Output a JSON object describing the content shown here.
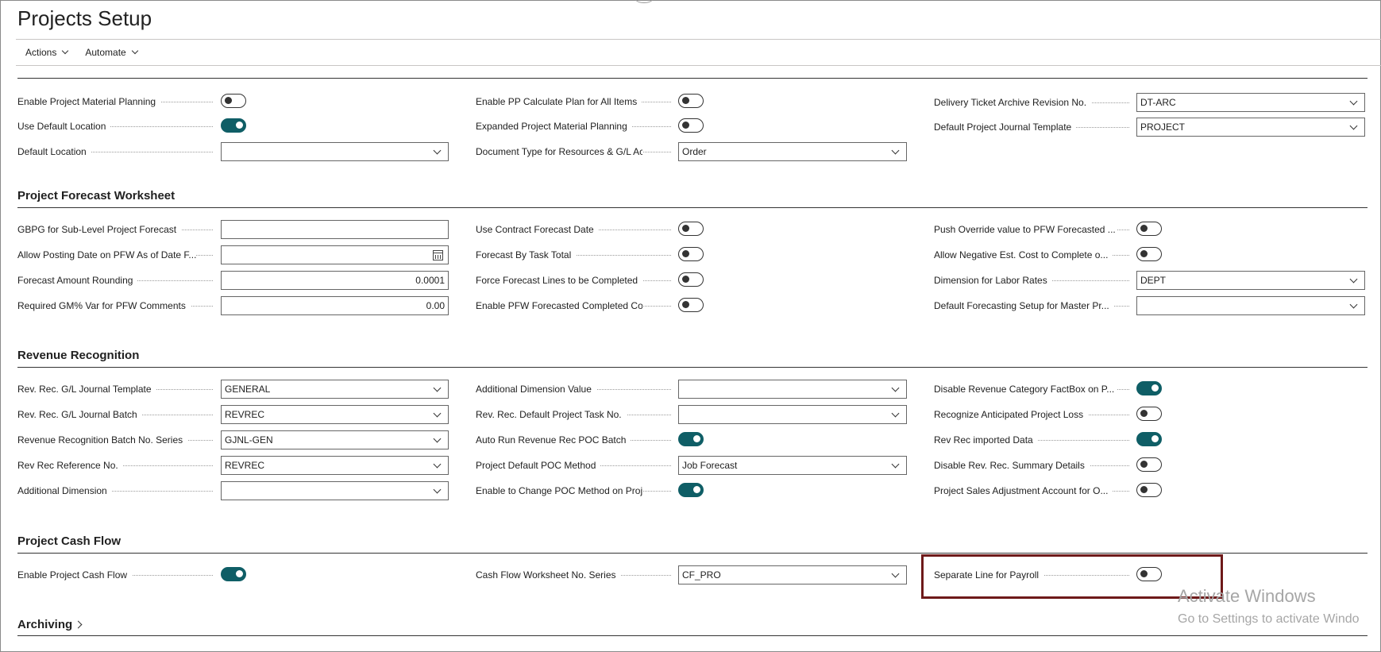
{
  "page": {
    "title": "Projects Setup"
  },
  "actions": [
    {
      "label": "Actions"
    },
    {
      "label": "Automate"
    }
  ],
  "sections": {
    "material": {
      "fields": {
        "enable_project_material_planning": {
          "label": "Enable Project Material Planning",
          "toggle": false
        },
        "use_default_location": {
          "label": "Use Default Location",
          "toggle": true
        },
        "default_location": {
          "label": "Default Location",
          "value": ""
        },
        "enable_pp_calculate_plan": {
          "label": "Enable PP Calculate Plan for All Items",
          "toggle": false
        },
        "expanded_project_material_planning": {
          "label": "Expanded Project Material Planning",
          "toggle": false
        },
        "document_type_resources": {
          "label": "Document Type for Resources & G/L Ac...",
          "value": "Order"
        },
        "delivery_ticket_archive": {
          "label": "Delivery Ticket Archive Revision No.",
          "value": "DT-ARC"
        },
        "default_project_journal_template": {
          "label": "Default Project Journal Template",
          "value": "PROJECT"
        }
      }
    },
    "forecast": {
      "title": "Project Forecast Worksheet",
      "fields": {
        "gbpg": {
          "label": "GBPG for Sub-Level Project Forecast",
          "value": ""
        },
        "allow_posting_date": {
          "label": "Allow Posting Date on PFW As of Date F...",
          "value": ""
        },
        "forecast_amount_rounding": {
          "label": "Forecast Amount Rounding",
          "value": "0.0001"
        },
        "required_gm_var": {
          "label": "Required GM% Var for PFW Comments",
          "value": "0.00"
        },
        "use_contract_forecast_date": {
          "label": "Use Contract Forecast Date",
          "toggle": false
        },
        "forecast_by_task_total": {
          "label": "Forecast By Task Total",
          "toggle": false
        },
        "force_forecast_lines": {
          "label": "Force Forecast Lines to be Completed",
          "toggle": false
        },
        "enable_pfw_forecasted": {
          "label": "Enable PFW Forecasted Completed Cost...",
          "toggle": false
        },
        "push_override_value": {
          "label": "Push Override value to PFW Forecasted ...",
          "toggle": false
        },
        "allow_negative_est_cost": {
          "label": "Allow Negative Est. Cost to Complete o...",
          "toggle": false
        },
        "dimension_labor_rates": {
          "label": "Dimension for Labor Rates",
          "value": "DEPT"
        },
        "default_forecasting_setup": {
          "label": "Default Forecasting Setup for Master Pr...",
          "value": ""
        }
      }
    },
    "revenue": {
      "title": "Revenue Recognition",
      "fields": {
        "rev_rec_gl_journal_template": {
          "label": "Rev. Rec. G/L Journal Template",
          "value": "GENERAL"
        },
        "rev_rec_gl_journal_batch": {
          "label": "Rev. Rec. G/L Journal Batch",
          "value": "REVREC"
        },
        "revenue_recognition_batch_no_series": {
          "label": "Revenue Recognition Batch No. Series",
          "value": "GJNL-GEN"
        },
        "rev_rec_reference_no": {
          "label": "Rev Rec Reference No.",
          "value": "REVREC"
        },
        "additional_dimension": {
          "label": "Additional Dimension",
          "value": ""
        },
        "additional_dimension_value": {
          "label": "Additional Dimension Value",
          "value": ""
        },
        "rev_rec_default_project_task_no": {
          "label": "Rev. Rec. Default Project Task No.",
          "value": ""
        },
        "auto_run_revenue_rec_poc_batch": {
          "label": "Auto Run Revenue Rec POC Batch",
          "toggle": true
        },
        "project_default_poc_method": {
          "label": "Project Default POC Method",
          "value": "Job Forecast"
        },
        "enable_change_poc_method": {
          "label": "Enable to Change POC Method on Proj...",
          "toggle": true
        },
        "disable_revenue_category_factbox": {
          "label": "Disable Revenue Category FactBox on P...",
          "toggle": true
        },
        "recognize_anticipated_project_loss": {
          "label": "Recognize Anticipated Project Loss",
          "toggle": false
        },
        "rev_rec_imported_data": {
          "label": "Rev Rec imported Data",
          "toggle": true
        },
        "disable_rev_rec_summary_details": {
          "label": "Disable Rev. Rec. Summary Details",
          "toggle": false
        },
        "project_sales_adjustment_account": {
          "label": "Project Sales Adjustment Account for O...",
          "toggle": false
        }
      }
    },
    "cashflow": {
      "title": "Project Cash Flow",
      "fields": {
        "enable_project_cash_flow": {
          "label": "Enable Project Cash Flow",
          "toggle": true
        },
        "cash_flow_worksheet_no_series": {
          "label": "Cash Flow Worksheet No. Series",
          "value": "CF_PRO"
        },
        "separate_line_for_payroll": {
          "label": "Separate Line for Payroll",
          "toggle": false
        }
      }
    },
    "archiving": {
      "title": "Archiving"
    }
  },
  "watermark": {
    "line1": "Activate Windows",
    "line2": "Go to Settings to activate Windo"
  },
  "colors": {
    "toggle_on": "#0f5e66",
    "highlight": "#6e1a1a"
  }
}
